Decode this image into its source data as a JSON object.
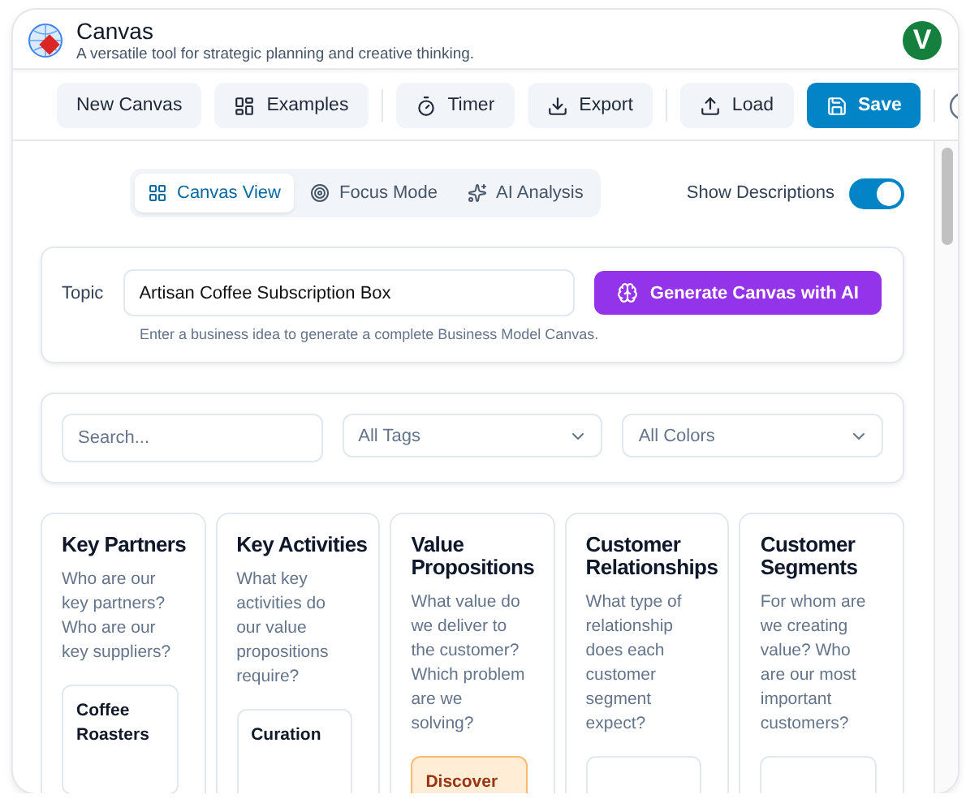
{
  "app": {
    "title": "Canvas",
    "subtitle": "A versatile tool for strategic planning and creative thinking.",
    "avatar": "V"
  },
  "toolbar": [
    {
      "label": "New Canvas",
      "kind": "plain"
    },
    {
      "label": "Examples",
      "kind": "examples"
    },
    {
      "kind": "divider"
    },
    {
      "label": "Timer",
      "kind": "timer"
    },
    {
      "label": "Export",
      "kind": "export"
    },
    {
      "kind": "divider"
    },
    {
      "label": "Load",
      "kind": "load"
    },
    {
      "label": "Save",
      "kind": "save"
    },
    {
      "kind": "divider"
    },
    {
      "kind": "help"
    }
  ],
  "view_tabs": [
    {
      "label": "Canvas View",
      "kind": "grid",
      "selected": true
    },
    {
      "label": "Focus Mode",
      "kind": "target",
      "selected": false
    },
    {
      "label": "AI Analysis",
      "kind": "sparkles",
      "selected": false
    }
  ],
  "show_descriptions": {
    "label": "Show Descriptions",
    "on": true
  },
  "topic": {
    "label": "Topic",
    "value": "Artisan Coffee Subscription Box",
    "hint": "Enter a business idea to generate a complete Business Model Canvas.",
    "button": "Generate Canvas with AI"
  },
  "filters": {
    "search_placeholder": "Search...",
    "tags": "All Tags",
    "colors": "All Colors"
  },
  "blocks": [
    {
      "title": "Key Partners",
      "description": "Who are our key partners? Who are our key suppliers?",
      "note": {
        "text": "Coffee Roasters",
        "color": "#ffffff"
      }
    },
    {
      "title": "Key Activities",
      "description": "What key activities do our value propositions require?",
      "note": {
        "text": "Curation",
        "color": "#ffffff"
      }
    },
    {
      "title": "Value Propositions",
      "description": "What value do we deliver to the customer? Which problem are we solving?",
      "note": {
        "text": "Discover",
        "color": "#ffedd5"
      }
    },
    {
      "title": "Customer Relationships",
      "description": "What type of relationship does each customer segment expect?",
      "note": {
        "color": "#ffffff"
      }
    },
    {
      "title": "Customer Segments",
      "description": "For whom are we creating value? Who are our most important customers?",
      "note": {
        "color": "#ffffff"
      }
    }
  ]
}
